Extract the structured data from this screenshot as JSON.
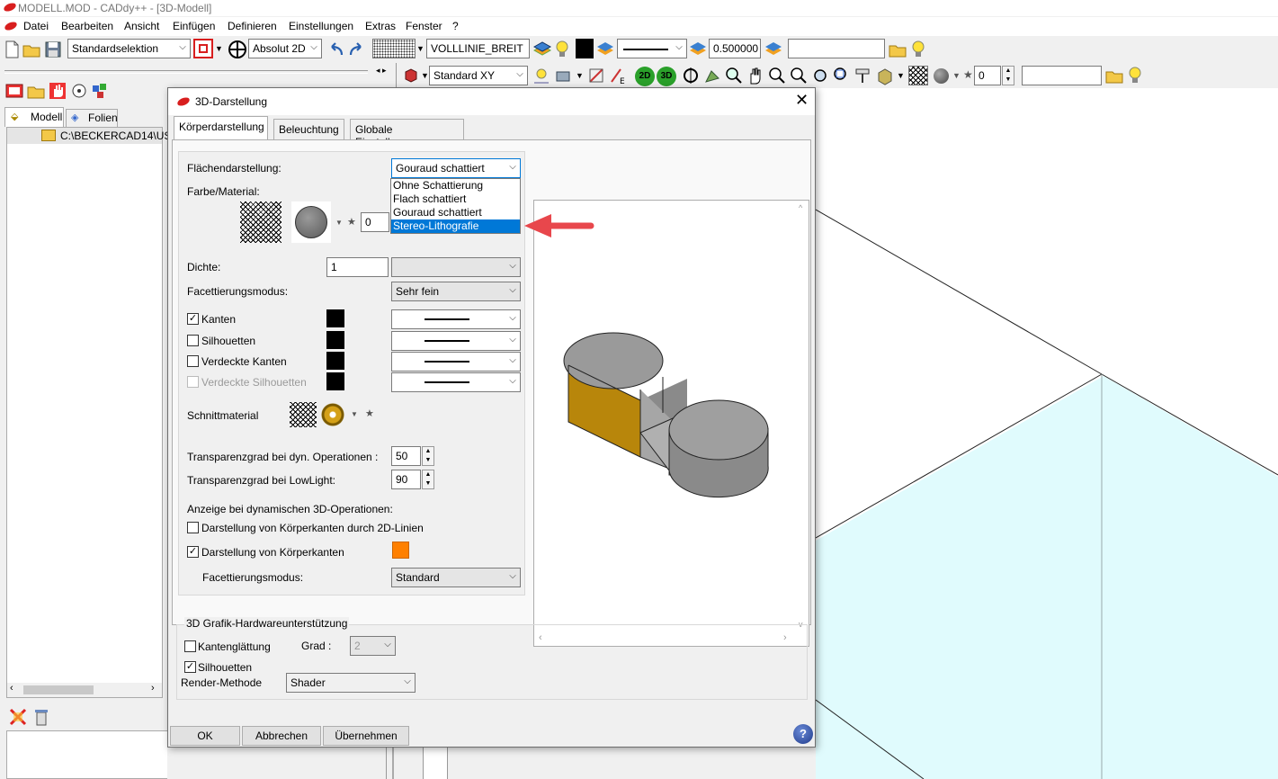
{
  "app": {
    "window_title": "MODELL.MOD  -  CADdy++ - [3D-Modell]",
    "menu": [
      "Datei",
      "Bearbeiten",
      "Ansicht",
      "Einfügen",
      "Definieren",
      "Einstellungen",
      "Extras",
      "Fenster",
      "?"
    ]
  },
  "toolbar1": {
    "selection_mode": "Standardselektion",
    "coord_mode": "Absolut 2D",
    "line_type": "VOLLLINIE_BREIT",
    "line_width": "0.500000",
    "layer_input": ""
  },
  "toolbar2": {
    "view": "Standard XY",
    "btn_2d": "2D",
    "btn_3d": "3D",
    "counter": "0",
    "search_input": ""
  },
  "left_panel": {
    "tabs": [
      "Modell",
      "Folien"
    ],
    "tree_item": "C:\\BECKERCAD14\\US"
  },
  "dialog": {
    "title": "3D-Darstellung",
    "tabs": [
      "Körperdarstellung",
      "Beleuchtung",
      "Globale Einstellungen"
    ],
    "flaechendarstellung": {
      "label": "Flächendarstellung:",
      "value": "Gouraud schattiert",
      "options": [
        "Ohne Schattierung",
        "Flach schattiert",
        "Gouraud schattiert",
        "Stereo-Lithografie"
      ],
      "highlighted": "Stereo-Lithografie"
    },
    "farbe_label": "Farbe/Material:",
    "farbe_value": "0",
    "dichte_label": "Dichte:",
    "dichte_value": "1",
    "facettierung_label": "Facettierungsmodus:",
    "facettierung_value": "Sehr fein",
    "edges": [
      {
        "label": "Kanten",
        "checked": true,
        "enabled": true
      },
      {
        "label": "Silhouetten",
        "checked": false,
        "enabled": true
      },
      {
        "label": "Verdeckte Kanten",
        "checked": false,
        "enabled": true
      },
      {
        "label": "Verdeckte Silhouetten",
        "checked": false,
        "enabled": false
      }
    ],
    "schnittmaterial_label": "Schnittmaterial",
    "transparenz_dyn_label": "Transparenzgrad bei dyn. Operationen :",
    "transparenz_dyn_value": "50",
    "transparenz_low_label": "Transparenzgrad bei LowLight:",
    "transparenz_low_value": "90",
    "anzeige_label": "Anzeige bei dynamischen 3D-Operationen:",
    "cb_2d_linien": {
      "label": "Darstellung von Körperkanten durch 2D-Linien",
      "checked": false
    },
    "cb_koerperkanten": {
      "label": "Darstellung von Körperkanten",
      "checked": true
    },
    "edge_color": "#ff8000",
    "dyn_facettierung_label": "Facettierungsmodus:",
    "dyn_facettierung_value": "Standard",
    "hardware_group": "3D Grafik-Hardwareunterstützung",
    "kantenglaettung": {
      "label": "Kantenglättung",
      "checked": false
    },
    "grad_label": "Grad :",
    "grad_value": "2",
    "silhouetten_hw": {
      "label": "Silhouetten",
      "checked": true
    },
    "render_label": "Render-Methode",
    "render_value": "Shader",
    "buttons": {
      "ok": "OK",
      "cancel": "Abbrechen",
      "apply": "Übernehmen"
    }
  },
  "colors": {
    "accent": "#0078d7",
    "logo_red": "#d81e1e",
    "arrow_red": "#e8474c",
    "model_orange": "#b8860b",
    "model_grey": "#a6a6a6",
    "canvas_cyan": "#e0fbfd"
  },
  "icons": [
    "new-file-icon",
    "open-folder-icon",
    "save-icon",
    "undo-icon",
    "redo-icon",
    "layers-icon",
    "bulb-icon",
    "hand-icon",
    "zoom-icon",
    "help-icon",
    "close-icon"
  ]
}
